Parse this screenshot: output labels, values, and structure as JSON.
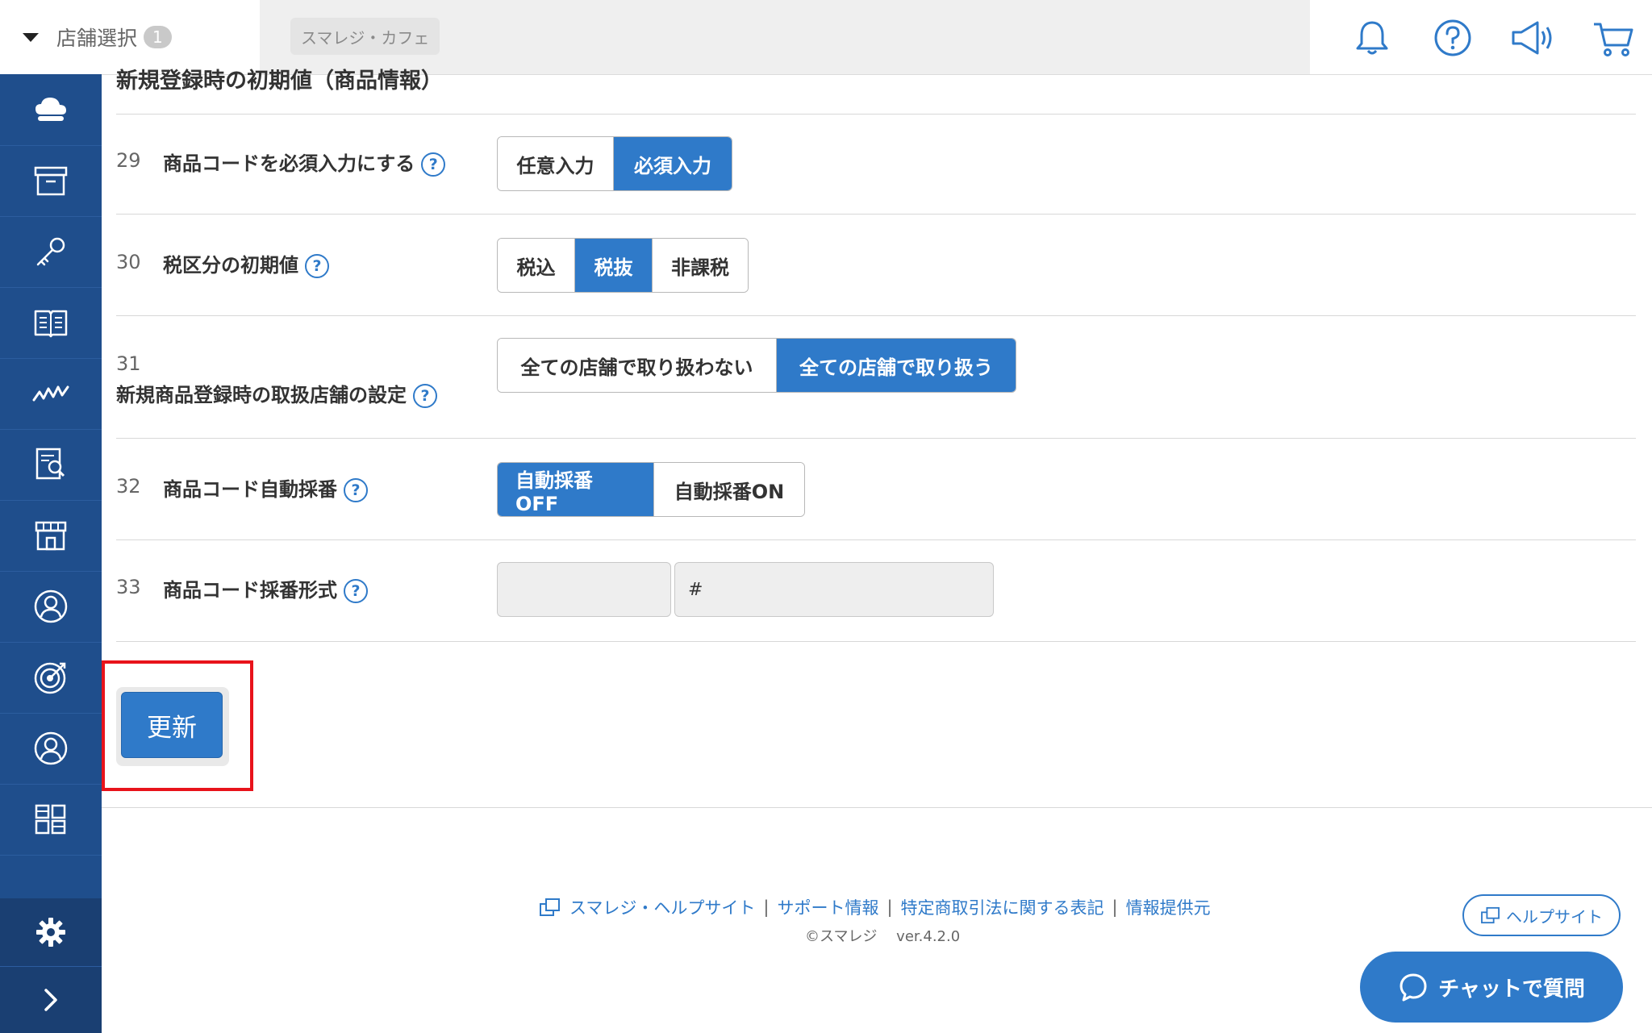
{
  "header": {
    "store_select_label": "店舗選択",
    "store_count": "1",
    "store_name": "スマレジ・カフェ",
    "icons": [
      "bell-icon",
      "help-circle-icon",
      "megaphone-icon",
      "cart-icon"
    ]
  },
  "sidebar": {
    "items": [
      "cloud-icon",
      "archive-box-icon",
      "key-icon",
      "book-icon",
      "chart-line-icon",
      "report-search-icon",
      "store-icon",
      "user-circle-icon",
      "target-icon",
      "customer-icon",
      "grid-icon"
    ],
    "settings_icon": "gear-icon",
    "expand_icon": "chevron-right-icon"
  },
  "section": {
    "title": "新規登録時の初期値（商品情報）"
  },
  "rows": [
    {
      "num": "29",
      "label": "商品コードを必須入力にする",
      "help": "?",
      "options": [
        "任意入力",
        "必須入力"
      ],
      "selected": "必須入力"
    },
    {
      "num": "30",
      "label": "税区分の初期値",
      "help": "?",
      "options": [
        "税込",
        "税抜",
        "非課税"
      ],
      "selected": "税抜"
    },
    {
      "num": "31",
      "label": "新規商品登録時の取扱店舗の設定",
      "help": "?",
      "options": [
        "全ての店舗で取り扱わない",
        "全ての店舗で取り扱う"
      ],
      "selected": "全ての店舗で取り扱う"
    },
    {
      "num": "32",
      "label": "商品コード自動採番",
      "help": "?",
      "options": [
        "自動採番OFF",
        "自動採番ON"
      ],
      "selected": "自動採番OFF"
    },
    {
      "num": "33",
      "label": "商品コード採番形式",
      "help": "?",
      "inputs": [
        "",
        "#"
      ]
    }
  ],
  "update_button": "更新",
  "footer": {
    "links": [
      "スマレジ・ヘルプサイト",
      "サポート情報",
      "特定商取引法に関する表記",
      "情報提供元"
    ],
    "separator": "|",
    "copyright": "©スマレジ　 ver.4.2.0",
    "helpsite_button": "ヘルプサイト",
    "chat_button": "チャットで質問"
  },
  "colors": {
    "primary": "#2f7ac9",
    "sidebar": "#1f4e8c",
    "highlight": "#e8131b"
  }
}
